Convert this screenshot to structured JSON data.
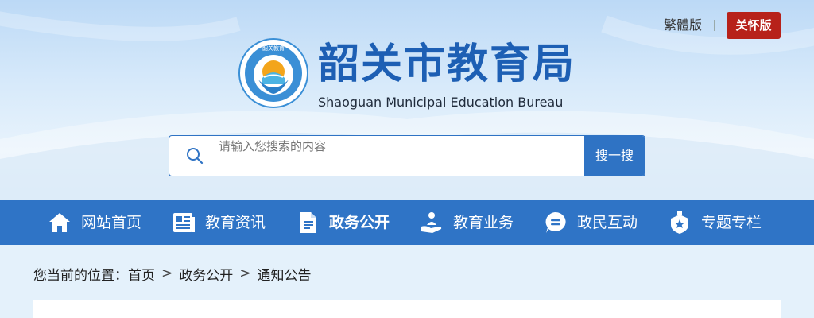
{
  "top_links": {
    "traditional": "繁體版",
    "care_mode": "关怀版"
  },
  "site": {
    "title": "韶关市教育局",
    "subtitle": "Shaoguan Municipal Education Bureau",
    "logo_ring_text": "韶关教育"
  },
  "search": {
    "placeholder": "请输入您搜索的内容",
    "button": "搜一搜"
  },
  "nav": {
    "items": [
      {
        "label": "网站首页",
        "icon": "home-icon"
      },
      {
        "label": "教育资讯",
        "icon": "news-icon"
      },
      {
        "label": "政务公开",
        "icon": "document-icon",
        "active": true
      },
      {
        "label": "教育业务",
        "icon": "service-icon"
      },
      {
        "label": "政民互动",
        "icon": "chat-icon"
      },
      {
        "label": "专题专栏",
        "icon": "badge-star-icon"
      }
    ]
  },
  "breadcrumb": {
    "prefix": "您当前的位置：",
    "items": [
      "首页",
      "政务公开",
      "通知公告"
    ],
    "separator": ">"
  },
  "colors": {
    "primary": "#2f74c6",
    "title_blue": "#1d5fb4",
    "care_red": "#b7211a",
    "page_bg": "#e4f1fb"
  }
}
